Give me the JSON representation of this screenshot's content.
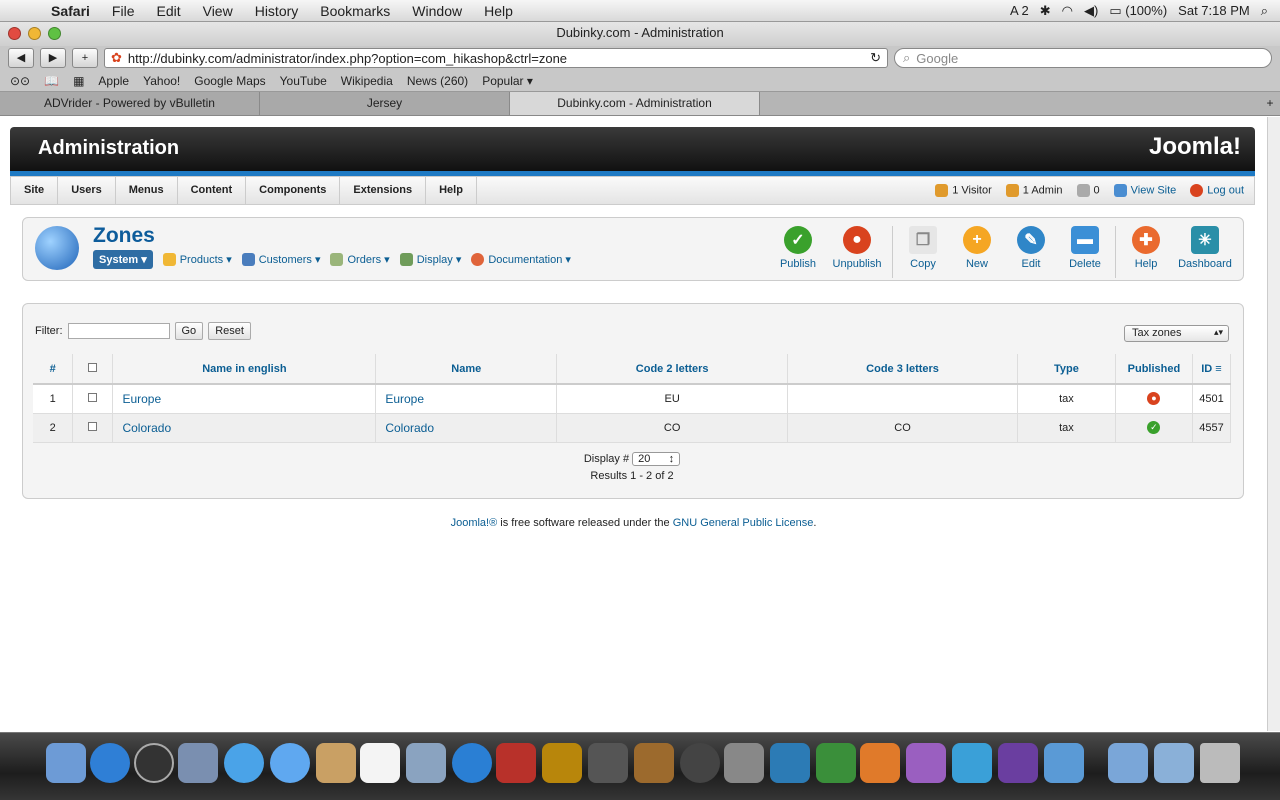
{
  "menubar": {
    "app": "Safari",
    "items": [
      "File",
      "Edit",
      "View",
      "History",
      "Bookmarks",
      "Window",
      "Help"
    ],
    "status_badge": "2",
    "battery": "(100%)",
    "clock": "Sat 7:18 PM"
  },
  "window": {
    "title": "Dubinky.com - Administration"
  },
  "toolbar": {
    "url": "http://dubinky.com/administrator/index.php?option=com_hikashop&ctrl=zone",
    "search_placeholder": "Google"
  },
  "bookmarks": [
    "Apple",
    "Yahoo!",
    "Google Maps",
    "YouTube",
    "Wikipedia",
    "News (260)",
    "Popular"
  ],
  "tabs": [
    "ADVrider - Powered by vBulletin",
    "Jersey",
    "Dubinky.com - Administration"
  ],
  "joomla": {
    "header_title": "Administration",
    "logo_text": "Joomla!",
    "menu": [
      "Site",
      "Users",
      "Menus",
      "Content",
      "Components",
      "Extensions",
      "Help"
    ],
    "status": {
      "visitors": "1 Visitor",
      "admins": "1 Admin",
      "messages": "0",
      "view_site": "View Site",
      "logout": "Log out"
    },
    "component_title": "Zones",
    "submenu": [
      "System",
      "Products",
      "Customers",
      "Orders",
      "Display",
      "Documentation"
    ],
    "actions": [
      "Publish",
      "Unpublish",
      "Copy",
      "New",
      "Edit",
      "Delete",
      "Help",
      "Dashboard"
    ]
  },
  "list": {
    "filter_label": "Filter:",
    "go": "Go",
    "reset": "Reset",
    "zone_type": "Tax zones",
    "headers": [
      "#",
      "Name in english",
      "Name",
      "Code 2 letters",
      "Code 3 letters",
      "Type",
      "Published",
      "ID"
    ],
    "rows": [
      {
        "num": "1",
        "name_en": "Europe",
        "name": "Europe",
        "code2": "EU",
        "code3": "",
        "type": "tax",
        "published": false,
        "id": "4501"
      },
      {
        "num": "2",
        "name_en": "Colorado",
        "name": "Colorado",
        "code2": "CO",
        "code3": "CO",
        "type": "tax",
        "published": true,
        "id": "4557"
      }
    ],
    "display_label": "Display #",
    "display_value": "20",
    "results": "Results 1 - 2 of 2"
  },
  "footer": {
    "joomla_link": "Joomla!®",
    "text": " is free software released under the ",
    "license_link": "GNU General Public License",
    "end": "."
  },
  "colors": {
    "accent": "#0b5e93",
    "joomla_blue": "#1e7ac4",
    "publish_green": "#3aa12c",
    "unpublish_red": "#d9431e"
  }
}
